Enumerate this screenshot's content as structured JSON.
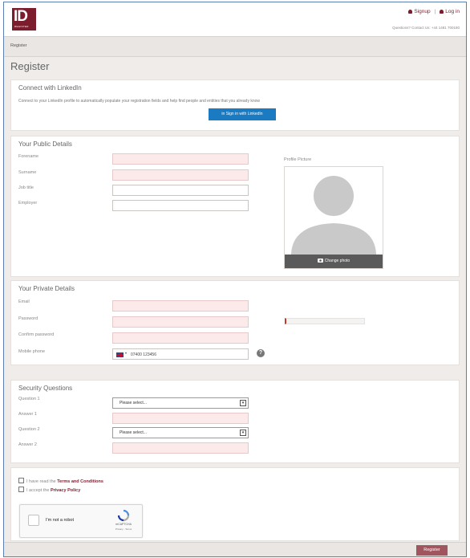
{
  "header": {
    "logo_text": "ID",
    "logo_sub": "REGISTER",
    "signup_label": "Signup",
    "separator": "|",
    "login_label": "Log in",
    "contact": "Questions? Contact Us: +44 1481 700180"
  },
  "breadcrumb": "Register",
  "page_title": "Register",
  "linkedin": {
    "title": "Connect with LinkedIn",
    "description": "Connect to your LinkedIn profile to automatically populate your registration fields and help find people and entities that you already know",
    "button": "in Sign in with LinkedIn"
  },
  "public_details": {
    "title": "Your Public Details",
    "forename_label": "Forename",
    "surname_label": "Surname",
    "jobtitle_label": "Job title",
    "employer_label": "Employer",
    "profile_picture_label": "Profile Picture",
    "change_photo": "Change photo"
  },
  "private_details": {
    "title": "Your Private Details",
    "email_label": "Email",
    "password_label": "Password",
    "confirm_label": "Confirm password",
    "mobile_label": "Mobile phone",
    "mobile_placeholder": "07400 123456",
    "help": "?"
  },
  "security": {
    "title": "Security Questions",
    "q1_label": "Question 1",
    "a1_label": "Answer 1",
    "q2_label": "Question 2",
    "a2_label": "Answer 2",
    "select_placeholder": "Please select...",
    "select_arrow": "▾"
  },
  "agreements": {
    "terms_prefix": "I have read the ",
    "terms_link": "Terms and Conditions",
    "privacy_prefix": "I accept the ",
    "privacy_link": "Privacy Policy"
  },
  "captcha": {
    "label": "I'm not a robot",
    "brand": "reCAPTCHA",
    "footer": "Privacy - Terms"
  },
  "footer": {
    "register_button": "Register"
  },
  "colors": {
    "brand": "#7c1d2e",
    "linkedin": "#1a7ac2",
    "required_field": "#fce9e9",
    "register_button": "#a0555f"
  }
}
